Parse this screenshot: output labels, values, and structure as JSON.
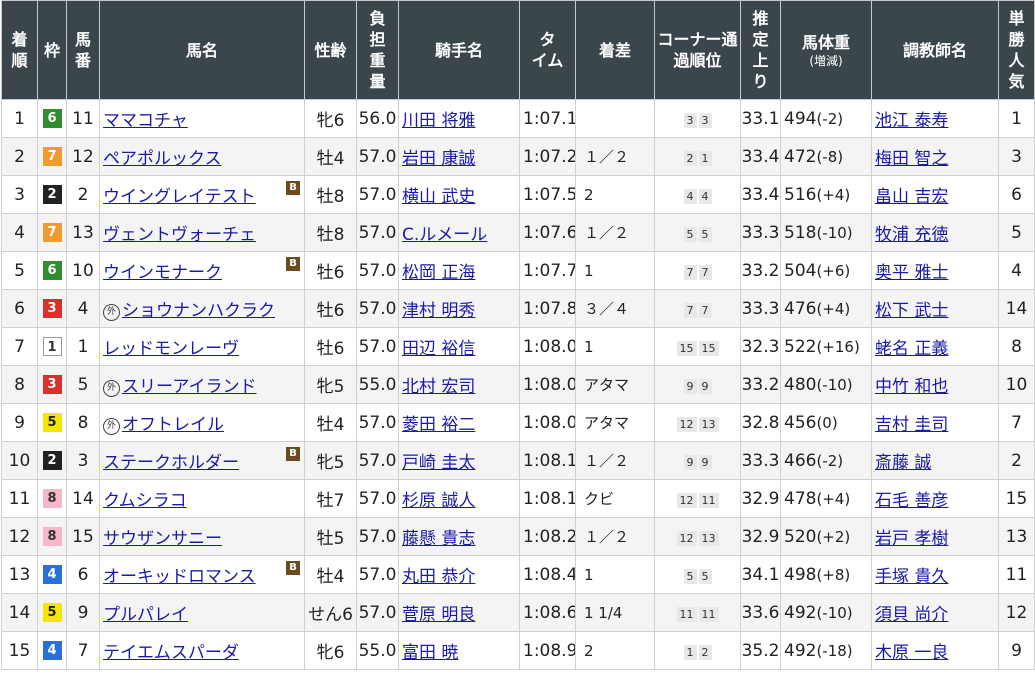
{
  "headers": {
    "rank": "着順",
    "waku": "枠",
    "umaban": "馬番",
    "horse": "馬名",
    "sexage": "性齢",
    "weight": "負担重量",
    "jockey": "騎手名",
    "time": "タイム",
    "margin": "着差",
    "corner": "コーナー通過順位",
    "last3f": "推定上り",
    "bodyweight": "馬体重",
    "bodyweight_sub": "(増減)",
    "trainer": "調教師名",
    "popularity": "単勝人気"
  },
  "colors": {
    "header_bg": "#3a464c",
    "link": "#1a1aa6",
    "waku1": "#ffffff",
    "waku2": "#222222",
    "waku3": "#d9302b",
    "waku4": "#2a6fd6",
    "waku5": "#f5e600",
    "waku6": "#2f8f2f",
    "waku7": "#f29a2e",
    "waku8": "#f6b7c8"
  },
  "rows": [
    {
      "rank": "1",
      "waku": "6",
      "umaban": "11",
      "mark": "",
      "horse": "ママコチャ",
      "blinker": false,
      "sexage": "牝6",
      "weight": "56.0",
      "jockey": "川田 将雅",
      "time": "1:07.1",
      "margin": "",
      "c1": "3",
      "c2": "3",
      "last3f": "33.1",
      "bw": "494",
      "bwd": "(-2)",
      "trainer": "池江 泰寿",
      "pop": "1"
    },
    {
      "rank": "2",
      "waku": "7",
      "umaban": "12",
      "mark": "",
      "horse": "ペアポルックス",
      "blinker": false,
      "sexage": "牡4",
      "weight": "57.0",
      "jockey": "岩田 康誠",
      "time": "1:07.2",
      "margin": "１／２",
      "c1": "2",
      "c2": "1",
      "last3f": "33.4",
      "bw": "472",
      "bwd": "(-8)",
      "trainer": "梅田 智之",
      "pop": "3"
    },
    {
      "rank": "3",
      "waku": "2",
      "umaban": "2",
      "mark": "",
      "horse": "ウイングレイテスト",
      "blinker": true,
      "sexage": "牡8",
      "weight": "57.0",
      "jockey": "横山 武史",
      "time": "1:07.5",
      "margin": "2",
      "c1": "4",
      "c2": "4",
      "last3f": "33.4",
      "bw": "516",
      "bwd": "(+4)",
      "trainer": "畠山 吉宏",
      "pop": "6"
    },
    {
      "rank": "4",
      "waku": "7",
      "umaban": "13",
      "mark": "",
      "horse": "ヴェントヴォーチェ",
      "blinker": false,
      "sexage": "牡8",
      "weight": "57.0",
      "jockey": "C.ルメール",
      "time": "1:07.6",
      "margin": "１／２",
      "c1": "5",
      "c2": "5",
      "last3f": "33.3",
      "bw": "518",
      "bwd": "(-10)",
      "trainer": "牧浦 充徳",
      "pop": "5"
    },
    {
      "rank": "5",
      "waku": "6",
      "umaban": "10",
      "mark": "",
      "horse": "ウインモナーク",
      "blinker": true,
      "sexage": "牡6",
      "weight": "57.0",
      "jockey": "松岡 正海",
      "time": "1:07.7",
      "margin": "1",
      "c1": "7",
      "c2": "7",
      "last3f": "33.2",
      "bw": "504",
      "bwd": "(+6)",
      "trainer": "奥平 雅士",
      "pop": "4"
    },
    {
      "rank": "6",
      "waku": "3",
      "umaban": "4",
      "mark": "外",
      "horse": "ショウナンハクラク",
      "blinker": false,
      "sexage": "牡6",
      "weight": "57.0",
      "jockey": "津村 明秀",
      "time": "1:07.8",
      "margin": "３／４",
      "c1": "7",
      "c2": "7",
      "last3f": "33.3",
      "bw": "476",
      "bwd": "(+4)",
      "trainer": "松下 武士",
      "pop": "14"
    },
    {
      "rank": "7",
      "waku": "1",
      "umaban": "1",
      "mark": "",
      "horse": "レッドモンレーヴ",
      "blinker": false,
      "sexage": "牡6",
      "weight": "57.0",
      "jockey": "田辺 裕信",
      "time": "1:08.0",
      "margin": "1",
      "c1": "15",
      "c2": "15",
      "last3f": "32.3",
      "bw": "522",
      "bwd": "(+16)",
      "trainer": "蛯名 正義",
      "pop": "8"
    },
    {
      "rank": "8",
      "waku": "3",
      "umaban": "5",
      "mark": "外",
      "horse": "スリーアイランド",
      "blinker": false,
      "sexage": "牝5",
      "weight": "55.0",
      "jockey": "北村 宏司",
      "time": "1:08.0",
      "margin": "アタマ",
      "c1": "9",
      "c2": "9",
      "last3f": "33.2",
      "bw": "480",
      "bwd": "(-10)",
      "trainer": "中竹 和也",
      "pop": "10"
    },
    {
      "rank": "9",
      "waku": "5",
      "umaban": "8",
      "mark": "外",
      "horse": "オフトレイル",
      "blinker": false,
      "sexage": "牡4",
      "weight": "57.0",
      "jockey": "菱田 裕二",
      "time": "1:08.0",
      "margin": "アタマ",
      "c1": "12",
      "c2": "13",
      "last3f": "32.8",
      "bw": "456",
      "bwd": "(0)",
      "trainer": "吉村 圭司",
      "pop": "7"
    },
    {
      "rank": "10",
      "waku": "2",
      "umaban": "3",
      "mark": "",
      "horse": "ステークホルダー",
      "blinker": true,
      "sexage": "牝5",
      "weight": "57.0",
      "jockey": "戸崎 圭太",
      "time": "1:08.1",
      "margin": "１／２",
      "c1": "9",
      "c2": "9",
      "last3f": "33.3",
      "bw": "466",
      "bwd": "(-2)",
      "trainer": "斎藤 誠",
      "pop": "2"
    },
    {
      "rank": "11",
      "waku": "8",
      "umaban": "14",
      "mark": "",
      "horse": "クムシラコ",
      "blinker": false,
      "sexage": "牡7",
      "weight": "57.0",
      "jockey": "杉原 誠人",
      "time": "1:08.1",
      "margin": "クビ",
      "c1": "12",
      "c2": "11",
      "last3f": "32.9",
      "bw": "478",
      "bwd": "(+4)",
      "trainer": "石毛 善彦",
      "pop": "15"
    },
    {
      "rank": "12",
      "waku": "8",
      "umaban": "15",
      "mark": "",
      "horse": "サウザンサニー",
      "blinker": false,
      "sexage": "牡5",
      "weight": "57.0",
      "jockey": "藤懸 貴志",
      "time": "1:08.2",
      "margin": "１／２",
      "c1": "12",
      "c2": "13",
      "last3f": "32.9",
      "bw": "520",
      "bwd": "(+2)",
      "trainer": "岩戸 孝樹",
      "pop": "13"
    },
    {
      "rank": "13",
      "waku": "4",
      "umaban": "6",
      "mark": "",
      "horse": "オーキッドロマンス",
      "blinker": true,
      "sexage": "牡4",
      "weight": "57.0",
      "jockey": "丸田 恭介",
      "time": "1:08.4",
      "margin": "1",
      "c1": "5",
      "c2": "5",
      "last3f": "34.1",
      "bw": "498",
      "bwd": "(+8)",
      "trainer": "手塚 貴久",
      "pop": "11"
    },
    {
      "rank": "14",
      "waku": "5",
      "umaban": "9",
      "mark": "",
      "horse": "プルパレイ",
      "blinker": false,
      "sexage": "せん6",
      "weight": "57.0",
      "jockey": "菅原 明良",
      "time": "1:08.6",
      "margin": "1 1/4",
      "c1": "11",
      "c2": "11",
      "last3f": "33.6",
      "bw": "492",
      "bwd": "(-10)",
      "trainer": "須貝 尚介",
      "pop": "12"
    },
    {
      "rank": "15",
      "waku": "4",
      "umaban": "7",
      "mark": "",
      "horse": "テイエムスパーダ",
      "blinker": false,
      "sexage": "牝6",
      "weight": "55.0",
      "jockey": "富田 暁",
      "time": "1:08.9",
      "margin": "2",
      "c1": "1",
      "c2": "2",
      "last3f": "35.2",
      "bw": "492",
      "bwd": "(-18)",
      "trainer": "木原 一良",
      "pop": "9"
    }
  ]
}
